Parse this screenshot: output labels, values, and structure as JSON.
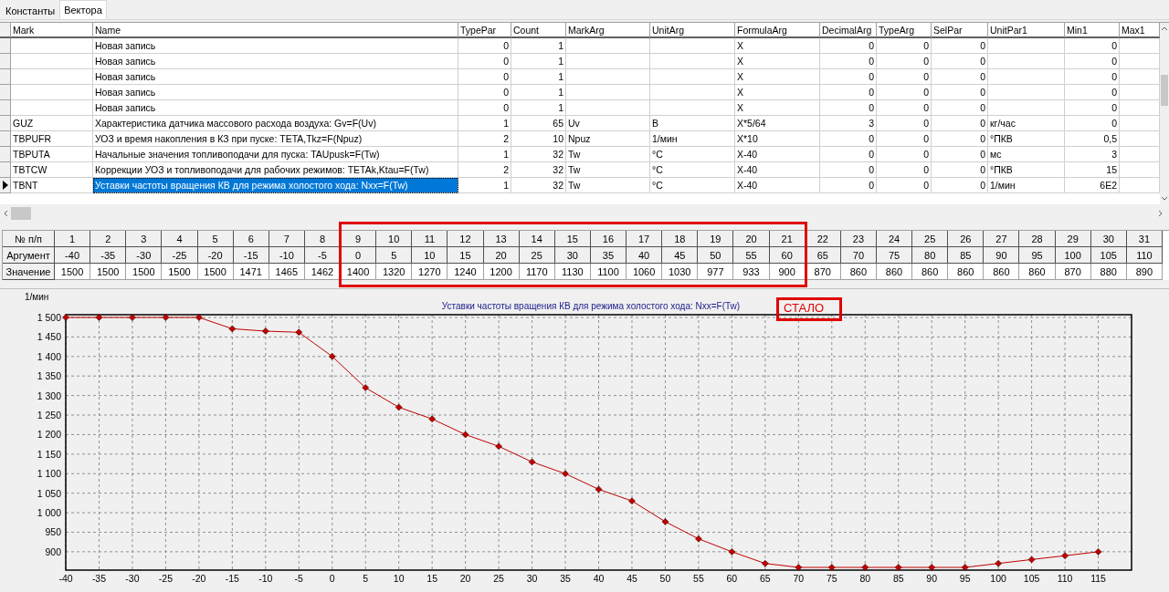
{
  "tabs": [
    {
      "label": "Константы",
      "selected": false
    },
    {
      "label": "Вектора",
      "selected": true
    }
  ],
  "table": {
    "columns": [
      {
        "label": "Mark",
        "kind": "text"
      },
      {
        "label": "Name",
        "kind": "text"
      },
      {
        "label": "TypePar",
        "kind": "number"
      },
      {
        "label": "Count",
        "kind": "number"
      },
      {
        "label": "MarkArg",
        "kind": "text"
      },
      {
        "label": "UnitArg",
        "kind": "text"
      },
      {
        "label": "FormulaArg",
        "kind": "text"
      },
      {
        "label": "DecimalArg",
        "kind": "number"
      },
      {
        "label": "TypeArg",
        "kind": "number"
      },
      {
        "label": "SelPar",
        "kind": "number"
      },
      {
        "label": "UnitPar1",
        "kind": "text"
      },
      {
        "label": "Min1",
        "kind": "number"
      },
      {
        "label": "Max1",
        "kind": "number"
      }
    ],
    "rows": [
      {
        "selected": false,
        "cells": [
          null,
          "Новая запись",
          "0",
          "1",
          null,
          null,
          "X",
          "0",
          "0",
          "0",
          null,
          "0"
        ]
      },
      {
        "selected": false,
        "cells": [
          null,
          "Новая запись",
          "0",
          "1",
          null,
          null,
          "X",
          "0",
          "0",
          "0",
          null,
          "0"
        ]
      },
      {
        "selected": false,
        "cells": [
          null,
          "Новая запись",
          "0",
          "1",
          null,
          null,
          "X",
          "0",
          "0",
          "0",
          null,
          "0"
        ]
      },
      {
        "selected": false,
        "cells": [
          null,
          "Новая запись",
          "0",
          "1",
          null,
          null,
          "X",
          "0",
          "0",
          "0",
          null,
          "0"
        ]
      },
      {
        "selected": false,
        "cells": [
          null,
          "Новая запись",
          "0",
          "1",
          null,
          null,
          "X",
          "0",
          "0",
          "0",
          null,
          "0"
        ]
      },
      {
        "selected": false,
        "cells": [
          "GUZ",
          "Характеристика датчика массового расхода воздуха: Gv=F(Uv)",
          "1",
          "65",
          "Uv",
          "В",
          "X*5/64",
          "3",
          "0",
          "0",
          "кг/час",
          "0"
        ]
      },
      {
        "selected": false,
        "cells": [
          "TBPUFR",
          "УОЗ и время накопления в КЗ при пуске: TETA,Tkz=F(Npuz)",
          "2",
          "10",
          "Npuz",
          "1/мин",
          "X*10",
          "0",
          "0",
          "0",
          "°ПКВ",
          "0,5"
        ]
      },
      {
        "selected": false,
        "cells": [
          "TBPUTA",
          "Начальные значения топливоподачи для пуска: TAUpusk=F(Tw)",
          "1",
          "32",
          "Tw",
          "°С",
          "X-40",
          "0",
          "0",
          "0",
          "мс",
          "3"
        ]
      },
      {
        "selected": false,
        "cells": [
          "TBTCW",
          "Коррекции УОЗ и топливоподачи для рабочих режимов: TETAk,Ktau=F(Tw)",
          "2",
          "32",
          "Tw",
          "°С",
          "X-40",
          "0",
          "0",
          "0",
          "°ПКВ",
          "15"
        ]
      },
      {
        "selected": true,
        "cells": [
          "TBNT",
          "Уставки частоты вращения КВ для режима холостого хода: Nxx=F(Tw)",
          "1",
          "32",
          "Tw",
          "°С",
          "X-40",
          "0",
          "0",
          "0",
          "1/мин",
          "6E2"
        ]
      }
    ]
  },
  "vector_table": {
    "row_labels": [
      "№ п/п",
      "Аргумент",
      "Значение"
    ],
    "columns": [
      {
        "number": "1",
        "argument": "-40",
        "value": "1500",
        "highlighted": false
      },
      {
        "number": "2",
        "argument": "-35",
        "value": "1500",
        "highlighted": false
      },
      {
        "number": "3",
        "argument": "-30",
        "value": "1500",
        "highlighted": false
      },
      {
        "number": "4",
        "argument": "-25",
        "value": "1500",
        "highlighted": false
      },
      {
        "number": "5",
        "argument": "-20",
        "value": "1500",
        "highlighted": false
      },
      {
        "number": "6",
        "argument": "-15",
        "value": "1471",
        "highlighted": false
      },
      {
        "number": "7",
        "argument": "-10",
        "value": "1465",
        "highlighted": false
      },
      {
        "number": "8",
        "argument": "-5",
        "value": "1462",
        "highlighted": false
      },
      {
        "number": "9",
        "argument": "0",
        "value": "1400",
        "highlighted": true
      },
      {
        "number": "10",
        "argument": "5",
        "value": "1320",
        "highlighted": true
      },
      {
        "number": "11",
        "argument": "10",
        "value": "1270",
        "highlighted": true
      },
      {
        "number": "12",
        "argument": "15",
        "value": "1240",
        "highlighted": true
      },
      {
        "number": "13",
        "argument": "20",
        "value": "1200",
        "highlighted": true
      },
      {
        "number": "14",
        "argument": "25",
        "value": "1170",
        "highlighted": true
      },
      {
        "number": "15",
        "argument": "30",
        "value": "1130",
        "highlighted": true
      },
      {
        "number": "16",
        "argument": "35",
        "value": "1100",
        "highlighted": true
      },
      {
        "number": "17",
        "argument": "40",
        "value": "1060",
        "highlighted": true
      },
      {
        "number": "18",
        "argument": "45",
        "value": "1030",
        "highlighted": true
      },
      {
        "number": "19",
        "argument": "50",
        "value": "977",
        "highlighted": true
      },
      {
        "number": "20",
        "argument": "55",
        "value": "933",
        "highlighted": true
      },
      {
        "number": "21",
        "argument": "60",
        "value": "900",
        "highlighted": true
      },
      {
        "number": "22",
        "argument": "65",
        "value": "870",
        "highlighted": false
      },
      {
        "number": "23",
        "argument": "70",
        "value": "860",
        "highlighted": false
      },
      {
        "number": "24",
        "argument": "75",
        "value": "860",
        "highlighted": false
      },
      {
        "number": "25",
        "argument": "80",
        "value": "860",
        "highlighted": false
      },
      {
        "number": "26",
        "argument": "85",
        "value": "860",
        "highlighted": false
      },
      {
        "number": "27",
        "argument": "90",
        "value": "860",
        "highlighted": false
      },
      {
        "number": "28",
        "argument": "95",
        "value": "860",
        "highlighted": false
      },
      {
        "number": "29",
        "argument": "100",
        "value": "870",
        "highlighted": false
      },
      {
        "number": "30",
        "argument": "105",
        "value": "880",
        "highlighted": false
      },
      {
        "number": "31",
        "argument": "110",
        "value": "890",
        "highlighted": false
      }
    ]
  },
  "chart": {
    "stamp": "СТАЛО",
    "chart_data": {
      "type": "line",
      "grid": true,
      "title": "Уставки частоты вращения КВ для режима холостого хода: Nxx=F(Tw)",
      "ylabel": "1/мин",
      "x": [
        -40,
        -35,
        -30,
        -25,
        -20,
        -15,
        -10,
        -5,
        0,
        5,
        10,
        15,
        20,
        25,
        30,
        35,
        40,
        45,
        50,
        55,
        60,
        65,
        70,
        75,
        80,
        85,
        90,
        95,
        100,
        105,
        110,
        115
      ],
      "series": [
        {
          "color": "#c00000",
          "marker": "diamond",
          "values": [
            1500,
            1500,
            1500,
            1500,
            1500,
            1471,
            1465,
            1462,
            1400,
            1320,
            1270,
            1240,
            1200,
            1170,
            1130,
            1100,
            1060,
            1030,
            977,
            933,
            900,
            870,
            860,
            860,
            860,
            860,
            860,
            860,
            870,
            880,
            890,
            900
          ]
        }
      ],
      "xlim": [
        -40,
        120
      ],
      "ylim": [
        853,
        1507
      ],
      "xticks": [
        -40,
        -35,
        -30,
        -25,
        -20,
        -15,
        -10,
        -5,
        0,
        5,
        10,
        15,
        20,
        25,
        30,
        35,
        40,
        45,
        50,
        55,
        60,
        65,
        70,
        75,
        80,
        85,
        90,
        95,
        100,
        105,
        110,
        115
      ],
      "yticks": [
        {
          "value": 1500,
          "label": "1 500"
        },
        {
          "value": 1450,
          "label": "1 450"
        },
        {
          "value": 1400,
          "label": "1 400"
        },
        {
          "value": 1350,
          "label": "1 350"
        },
        {
          "value": 1300,
          "label": "1 300"
        },
        {
          "value": 1250,
          "label": "1 250"
        },
        {
          "value": 1200,
          "label": "1 200"
        },
        {
          "value": 1150,
          "label": "1 150"
        },
        {
          "value": 1100,
          "label": "1 100"
        },
        {
          "value": 1050,
          "label": "1 050"
        },
        {
          "value": 1000,
          "label": "1 000"
        },
        {
          "value": 950,
          "label": "950"
        },
        {
          "value": 900,
          "label": "900"
        }
      ]
    }
  }
}
